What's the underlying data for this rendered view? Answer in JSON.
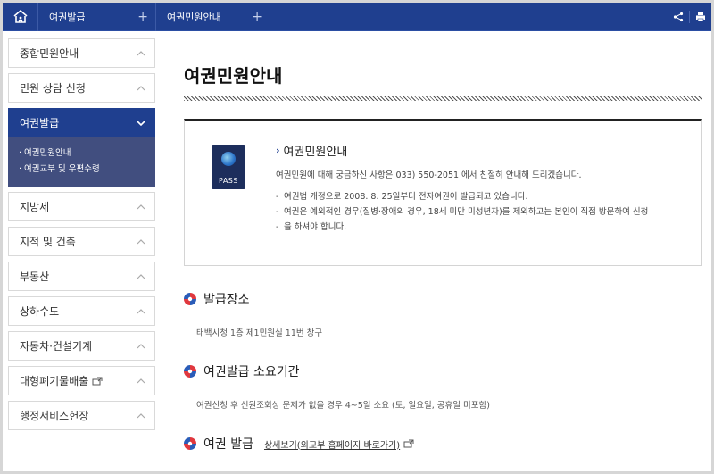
{
  "topbar": {
    "crumbs": [
      {
        "label": "여권발급",
        "plus": "+"
      },
      {
        "label": "여권민원안내",
        "plus": "+"
      }
    ]
  },
  "sidebar": {
    "items": [
      {
        "label": "종합민원안내"
      },
      {
        "label": "민원 상담 신청"
      },
      {
        "label": "여권발급"
      },
      {
        "label": "지방세"
      },
      {
        "label": "지적 및 건축"
      },
      {
        "label": "부동산"
      },
      {
        "label": "상하수도"
      },
      {
        "label": "자동차·건설기계"
      },
      {
        "label": "대형폐기물배출"
      },
      {
        "label": "행정서비스헌장"
      }
    ],
    "submenu": [
      "· 여권민원안내",
      "· 여권교부 및 우편수령"
    ]
  },
  "main": {
    "title": "여권민원안내",
    "info": {
      "badge": "PASS",
      "heading": "여권민원안내",
      "desc": "여권민원에 대해 궁금하신 사항은 033) 550-2051 에서 친절히 안내해 드리겠습니다.",
      "list": [
        "여권법 개정으로 2008. 8. 25일부터 전자여권이 발급되고 있습니다.",
        "여권은 예외적인 경우(질병·장애의 경우, 18세 미만 미성년자)를 제외하고는 본인이 직접 방문하여 신청",
        "을 하셔야 합니다."
      ]
    },
    "sections": [
      {
        "title": "발급장소",
        "body": "태백시청 1층 제1민원실 11번 창구"
      },
      {
        "title": "여권발급 소요기간",
        "body": "여권신청 후 신원조회상 문제가 없을 경우 4~5일 소요 (토, 일요일, 공휴일 미포함)"
      },
      {
        "title": "여권 발급",
        "link": "상세보기(외교부 홈페이지 바로가기)"
      }
    ]
  },
  "colors": {
    "primary": "#1f3f8f",
    "submenu_bg": "#414e7f",
    "icon_red": "#e0383e",
    "icon_blue": "#2a5cb8"
  }
}
